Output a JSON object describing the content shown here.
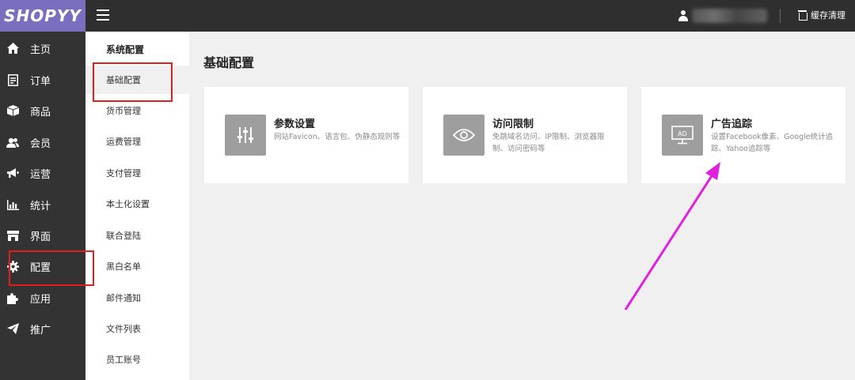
{
  "logo": "SHOPYY",
  "topbar": {
    "cache_label": "缓存清理"
  },
  "sidebar": {
    "items": [
      {
        "label": "主页",
        "icon": "home-icon"
      },
      {
        "label": "订单",
        "icon": "order-icon"
      },
      {
        "label": "商品",
        "icon": "product-icon"
      },
      {
        "label": "会员",
        "icon": "members-icon"
      },
      {
        "label": "运营",
        "icon": "megaphone-icon"
      },
      {
        "label": "统计",
        "icon": "chart-icon"
      },
      {
        "label": "界面",
        "icon": "store-icon"
      },
      {
        "label": "配置",
        "icon": "gear-icon"
      },
      {
        "label": "应用",
        "icon": "puzzle-icon"
      },
      {
        "label": "推广",
        "icon": "send-icon"
      }
    ]
  },
  "submenu": {
    "header": "系统配置",
    "items": [
      {
        "label": "基础配置"
      },
      {
        "label": "货币管理"
      },
      {
        "label": "运费管理"
      },
      {
        "label": "支付管理"
      },
      {
        "label": "本土化设置"
      },
      {
        "label": "联合登陆"
      },
      {
        "label": "黑白名单"
      },
      {
        "label": "邮件通知"
      },
      {
        "label": "文件列表"
      },
      {
        "label": "员工账号"
      }
    ]
  },
  "main": {
    "title": "基础配置",
    "cards": [
      {
        "title": "参数设置",
        "desc": "网站Favicon、语言包、伪静态规则等",
        "icon": "sliders-icon"
      },
      {
        "title": "访问限制",
        "desc": "免跳域名访问、IP限制、浏览器限制、访问密码等",
        "icon": "eye-icon"
      },
      {
        "title": "广告追踪",
        "desc": "设置Facebook像素、Google统计追踪、Yahoo追踪等",
        "icon": "ad-icon",
        "icon_text": "AD"
      }
    ]
  },
  "colors": {
    "logo_bg": "#7a6fbf",
    "topbar_bg": "#2f2f2f",
    "sidebar_bg": "#333333",
    "annotation_red": "#e02020",
    "annotation_arrow": "#e020e0"
  }
}
